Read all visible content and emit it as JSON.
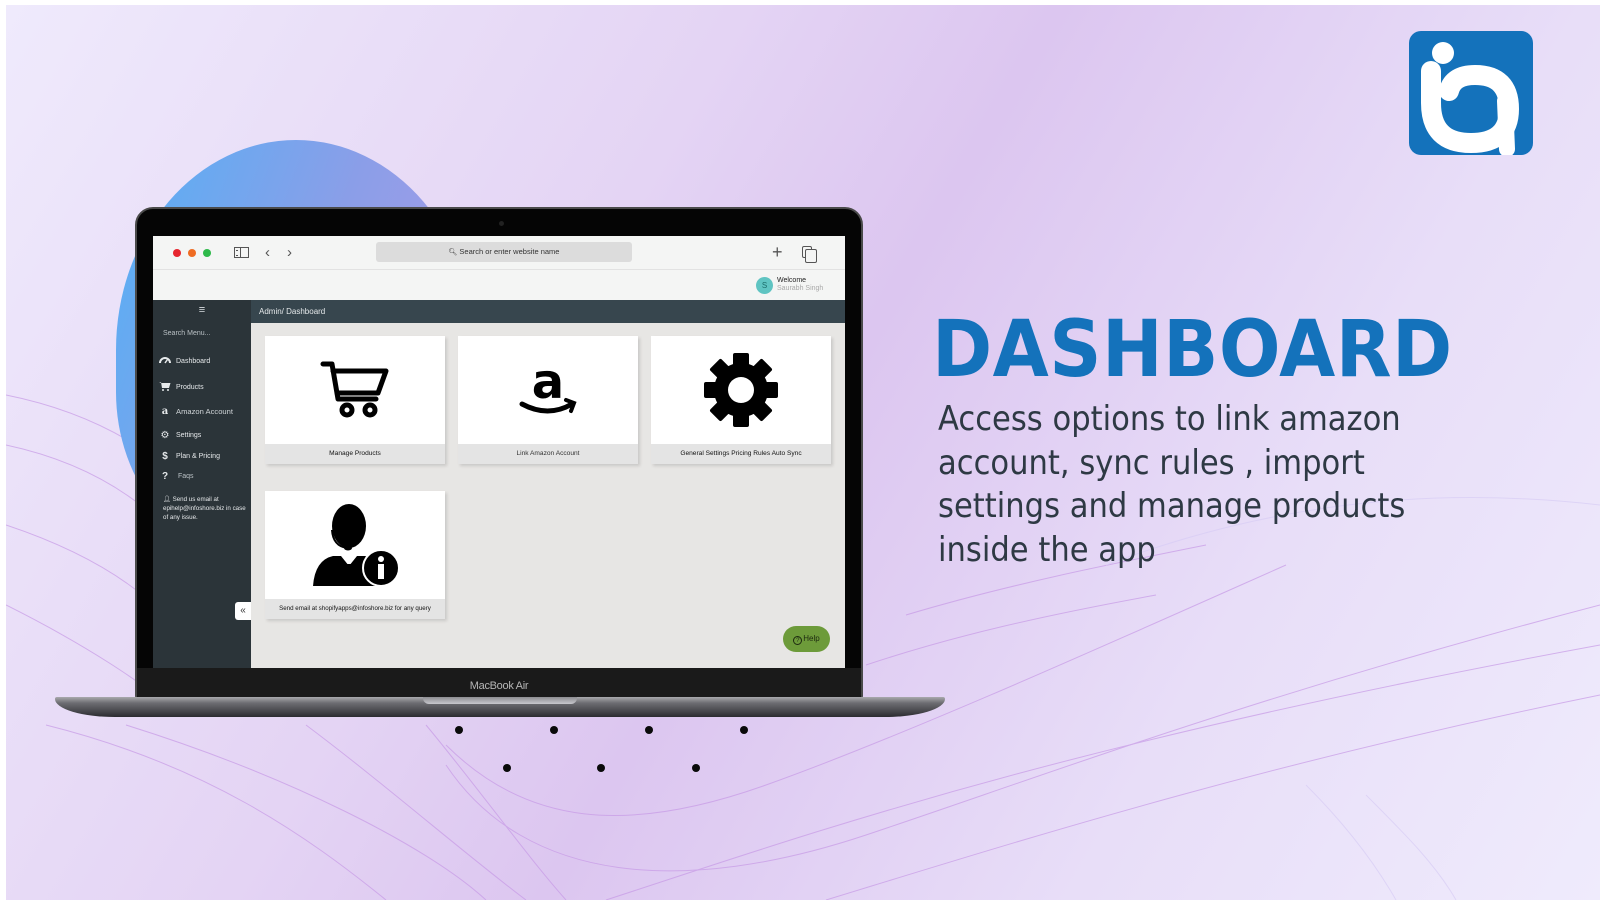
{
  "hero": {
    "headline": "DASHBOARD",
    "description": "Access options to link amazon account, sync rules , import settings and manage products inside the app",
    "accent_color": "#1472bb",
    "logo": "infoshore-ia-logo"
  },
  "laptop": {
    "brand": "MacBook Air"
  },
  "browser": {
    "address_placeholder": "Search or enter website name",
    "search_icon": "search-icon",
    "new_tab_icon": "+",
    "back_icon": "‹",
    "forward_icon": "›"
  },
  "user": {
    "avatar_initial": "S",
    "greeting": "Welcome",
    "name": "Saurabh Singh"
  },
  "sidebar": {
    "menu_icon": "≡",
    "search_placeholder": "Search Menu...",
    "items": [
      {
        "label": "Dashboard",
        "icon": "dashboard-gauge-icon"
      },
      {
        "label": "Products",
        "icon": "cart-icon"
      },
      {
        "label": "Amazon Account",
        "icon": "amazon-icon"
      },
      {
        "label": "Settings",
        "icon": "gear-icon"
      },
      {
        "label": "Plan & Pricing",
        "icon": "dollar-icon"
      },
      {
        "label": "Faqs",
        "icon": "question-icon"
      }
    ],
    "support_note": "Send us email at epihelp@infoshore.biz in case of any issue.",
    "collapse_icon": "«"
  },
  "breadcrumb": "Admin/ Dashboard",
  "cards": [
    {
      "label": "Manage Products",
      "icon": "cart-icon"
    },
    {
      "label": "Link Amazon Account",
      "icon": "amazon-icon"
    },
    {
      "label": "General Settings Pricing Rules Auto Sync",
      "icon": "gear-icon"
    },
    {
      "label": "Send email at shopifyapps@infoshore.biz for any query",
      "icon": "support-agent-icon"
    }
  ],
  "help_button": {
    "label": "Help",
    "icon": "?",
    "color": "#6d9b3a"
  }
}
